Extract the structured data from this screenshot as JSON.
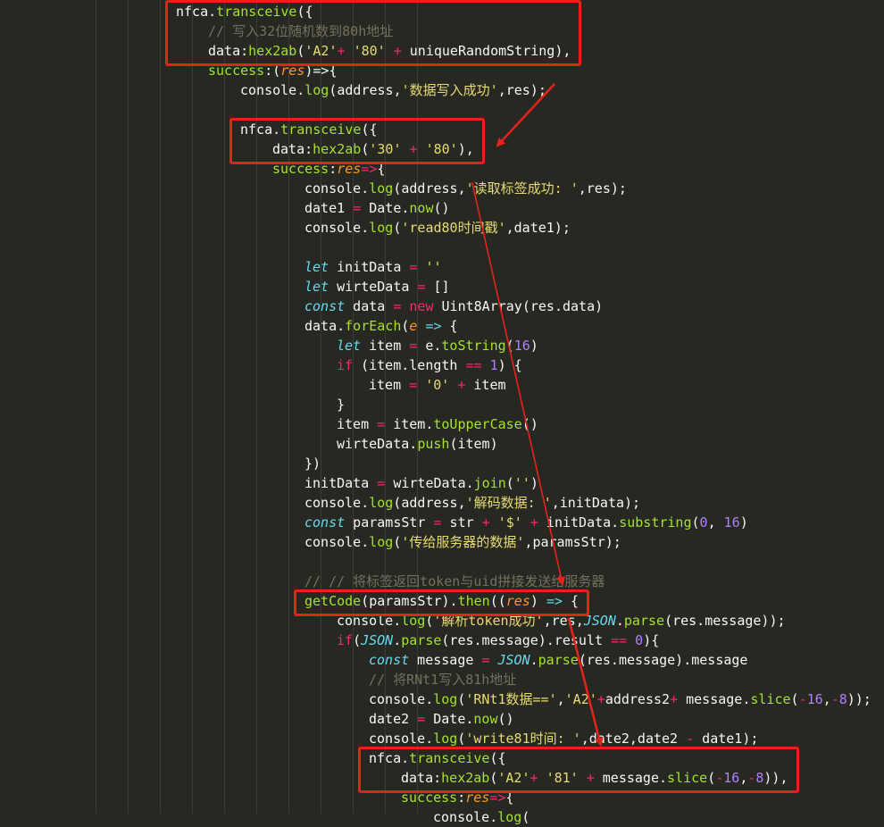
{
  "editor": {
    "theme": {
      "background": "#272822",
      "indent_guide": "#3b3c35",
      "annotation": "#e8221b"
    },
    "lines": [
      {
        "indent": 3,
        "tokens": [
          [
            "plain",
            "nfca."
          ],
          [
            "fn",
            "transceive"
          ],
          [
            "plain",
            "({"
          ]
        ]
      },
      {
        "indent": 4,
        "tokens": [
          [
            "cm",
            "// 写入32位随机数到80h地址"
          ]
        ]
      },
      {
        "indent": 4,
        "tokens": [
          [
            "plain",
            "data:"
          ],
          [
            "fn",
            "hex2ab"
          ],
          [
            "plain",
            "("
          ],
          [
            "str",
            "'A2'"
          ],
          [
            "op",
            "+"
          ],
          [
            "plain",
            " "
          ],
          [
            "str",
            "'80'"
          ],
          [
            "plain",
            " "
          ],
          [
            "op",
            "+"
          ],
          [
            "plain",
            " uniqueRandomString),"
          ]
        ]
      },
      {
        "indent": 4,
        "tokens": [
          [
            "fn",
            "success"
          ],
          [
            "plain",
            ":("
          ],
          [
            "par",
            "res"
          ],
          [
            "plain",
            ")=>{"
          ]
        ]
      },
      {
        "indent": 5,
        "tokens": [
          [
            "plain",
            "console."
          ],
          [
            "fn",
            "log"
          ],
          [
            "plain",
            "(address,"
          ],
          [
            "str",
            "'数据写入成功'"
          ],
          [
            "plain",
            ",res);"
          ]
        ]
      },
      {
        "indent": 0,
        "tokens": []
      },
      {
        "indent": 5,
        "tokens": [
          [
            "plain",
            "nfca."
          ],
          [
            "fn",
            "transceive"
          ],
          [
            "plain",
            "({"
          ]
        ]
      },
      {
        "indent": 6,
        "tokens": [
          [
            "plain",
            "data:"
          ],
          [
            "fn",
            "hex2ab"
          ],
          [
            "plain",
            "("
          ],
          [
            "str",
            "'30'"
          ],
          [
            "plain",
            " "
          ],
          [
            "op",
            "+"
          ],
          [
            "plain",
            " "
          ],
          [
            "str",
            "'80'"
          ],
          [
            "plain",
            "),"
          ]
        ]
      },
      {
        "indent": 6,
        "tokens": [
          [
            "fn",
            "success"
          ],
          [
            "plain",
            ":"
          ],
          [
            "par",
            "res"
          ],
          [
            "op",
            "=>"
          ],
          [
            "plain",
            "{"
          ]
        ]
      },
      {
        "indent": 7,
        "tokens": [
          [
            "plain",
            "console."
          ],
          [
            "fn",
            "log"
          ],
          [
            "plain",
            "(address,"
          ],
          [
            "str",
            "'读取标签成功: '"
          ],
          [
            "plain",
            ",res);"
          ]
        ]
      },
      {
        "indent": 7,
        "tokens": [
          [
            "plain",
            "date1 "
          ],
          [
            "op",
            "="
          ],
          [
            "plain",
            " Date."
          ],
          [
            "fn",
            "now"
          ],
          [
            "plain",
            "()"
          ]
        ]
      },
      {
        "indent": 7,
        "tokens": [
          [
            "plain",
            "console."
          ],
          [
            "fn",
            "log"
          ],
          [
            "plain",
            "("
          ],
          [
            "str",
            "'read80时间戳'"
          ],
          [
            "plain",
            ",date1);"
          ]
        ]
      },
      {
        "indent": 0,
        "tokens": []
      },
      {
        "indent": 7,
        "tokens": [
          [
            "kw",
            "let"
          ],
          [
            "plain",
            " initData "
          ],
          [
            "op",
            "="
          ],
          [
            "plain",
            " "
          ],
          [
            "str",
            "''"
          ]
        ]
      },
      {
        "indent": 7,
        "tokens": [
          [
            "kw",
            "let"
          ],
          [
            "plain",
            " wirteData "
          ],
          [
            "op",
            "="
          ],
          [
            "plain",
            " []"
          ]
        ]
      },
      {
        "indent": 7,
        "tokens": [
          [
            "kw",
            "const"
          ],
          [
            "plain",
            " data "
          ],
          [
            "op",
            "="
          ],
          [
            "plain",
            " "
          ],
          [
            "op",
            "new"
          ],
          [
            "plain",
            " Uint8Array(res.data)"
          ]
        ]
      },
      {
        "indent": 7,
        "tokens": [
          [
            "plain",
            "data."
          ],
          [
            "fn",
            "forEach"
          ],
          [
            "plain",
            "("
          ],
          [
            "par",
            "e"
          ],
          [
            "plain",
            " "
          ],
          [
            "kw",
            "=>"
          ],
          [
            "plain",
            " {"
          ]
        ]
      },
      {
        "indent": 8,
        "tokens": [
          [
            "kw",
            "let"
          ],
          [
            "plain",
            " item "
          ],
          [
            "op",
            "="
          ],
          [
            "plain",
            " e."
          ],
          [
            "fn",
            "toString"
          ],
          [
            "plain",
            "("
          ],
          [
            "num",
            "16"
          ],
          [
            "plain",
            ")"
          ]
        ]
      },
      {
        "indent": 8,
        "tokens": [
          [
            "op",
            "if"
          ],
          [
            "plain",
            " (item.length "
          ],
          [
            "op",
            "=="
          ],
          [
            "plain",
            " "
          ],
          [
            "num",
            "1"
          ],
          [
            "plain",
            ") {"
          ]
        ]
      },
      {
        "indent": 9,
        "tokens": [
          [
            "plain",
            "item "
          ],
          [
            "op",
            "="
          ],
          [
            "plain",
            " "
          ],
          [
            "str",
            "'0'"
          ],
          [
            "plain",
            " "
          ],
          [
            "op",
            "+"
          ],
          [
            "plain",
            " item"
          ]
        ]
      },
      {
        "indent": 8,
        "tokens": [
          [
            "plain",
            "}"
          ]
        ]
      },
      {
        "indent": 8,
        "tokens": [
          [
            "plain",
            "item "
          ],
          [
            "op",
            "="
          ],
          [
            "plain",
            " item."
          ],
          [
            "fn",
            "toUpperCase"
          ],
          [
            "plain",
            "()"
          ]
        ]
      },
      {
        "indent": 8,
        "tokens": [
          [
            "plain",
            "wirteData."
          ],
          [
            "fn",
            "push"
          ],
          [
            "plain",
            "(item)"
          ]
        ]
      },
      {
        "indent": 7,
        "tokens": [
          [
            "plain",
            "})"
          ]
        ]
      },
      {
        "indent": 7,
        "tokens": [
          [
            "plain",
            "initData "
          ],
          [
            "op",
            "="
          ],
          [
            "plain",
            " wirteData."
          ],
          [
            "fn",
            "join"
          ],
          [
            "plain",
            "("
          ],
          [
            "str",
            "''"
          ],
          [
            "plain",
            ")"
          ]
        ]
      },
      {
        "indent": 7,
        "tokens": [
          [
            "plain",
            "console."
          ],
          [
            "fn",
            "log"
          ],
          [
            "plain",
            "(address,"
          ],
          [
            "str",
            "'解码数据: '"
          ],
          [
            "plain",
            ",initData);"
          ]
        ]
      },
      {
        "indent": 7,
        "tokens": [
          [
            "kw",
            "const"
          ],
          [
            "plain",
            " paramsStr "
          ],
          [
            "op",
            "="
          ],
          [
            "plain",
            " str "
          ],
          [
            "op",
            "+"
          ],
          [
            "plain",
            " "
          ],
          [
            "str",
            "'$'"
          ],
          [
            "plain",
            " "
          ],
          [
            "op",
            "+"
          ],
          [
            "plain",
            " initData."
          ],
          [
            "fn",
            "substring"
          ],
          [
            "plain",
            "("
          ],
          [
            "num",
            "0"
          ],
          [
            "plain",
            ", "
          ],
          [
            "num",
            "16"
          ],
          [
            "plain",
            ")"
          ]
        ]
      },
      {
        "indent": 7,
        "tokens": [
          [
            "plain",
            "console."
          ],
          [
            "fn",
            "log"
          ],
          [
            "plain",
            "("
          ],
          [
            "str",
            "'传给服务器的数据'"
          ],
          [
            "plain",
            ",paramsStr);"
          ]
        ]
      },
      {
        "indent": 0,
        "tokens": []
      },
      {
        "indent": 7,
        "tokens": [
          [
            "cm",
            "// // 将标签返回token与uid拼接发送给服务器"
          ]
        ]
      },
      {
        "indent": 7,
        "tokens": [
          [
            "fn",
            "getCode"
          ],
          [
            "plain",
            "(paramsStr)."
          ],
          [
            "fn",
            "then"
          ],
          [
            "plain",
            "(("
          ],
          [
            "par",
            "res"
          ],
          [
            "plain",
            ") "
          ],
          [
            "kw",
            "=>"
          ],
          [
            "plain",
            " {"
          ]
        ]
      },
      {
        "indent": 8,
        "tokens": [
          [
            "plain",
            "console."
          ],
          [
            "fn",
            "log"
          ],
          [
            "plain",
            "("
          ],
          [
            "str",
            "'解析token成功'"
          ],
          [
            "plain",
            ",res,"
          ],
          [
            "kw",
            "JSON"
          ],
          [
            "plain",
            "."
          ],
          [
            "fn",
            "parse"
          ],
          [
            "plain",
            "(res.message));"
          ]
        ]
      },
      {
        "indent": 8,
        "tokens": [
          [
            "op",
            "if"
          ],
          [
            "plain",
            "("
          ],
          [
            "kw",
            "JSON"
          ],
          [
            "plain",
            "."
          ],
          [
            "fn",
            "parse"
          ],
          [
            "plain",
            "(res.message).result "
          ],
          [
            "op",
            "=="
          ],
          [
            "plain",
            " "
          ],
          [
            "num",
            "0"
          ],
          [
            "plain",
            "){"
          ]
        ]
      },
      {
        "indent": 9,
        "tokens": [
          [
            "kw",
            "const"
          ],
          [
            "plain",
            " message "
          ],
          [
            "op",
            "="
          ],
          [
            "plain",
            " "
          ],
          [
            "kw",
            "JSON"
          ],
          [
            "plain",
            "."
          ],
          [
            "fn",
            "parse"
          ],
          [
            "plain",
            "(res.message).message"
          ]
        ]
      },
      {
        "indent": 9,
        "tokens": [
          [
            "cm",
            "// 将RNt1写入81h地址"
          ]
        ]
      },
      {
        "indent": 9,
        "tokens": [
          [
            "plain",
            "console."
          ],
          [
            "fn",
            "log"
          ],
          [
            "plain",
            "("
          ],
          [
            "str",
            "'RNt1数据=='"
          ],
          [
            "plain",
            ","
          ],
          [
            "str",
            "'A2'"
          ],
          [
            "op",
            "+"
          ],
          [
            "plain",
            "address2"
          ],
          [
            "op",
            "+"
          ],
          [
            "plain",
            " message."
          ],
          [
            "fn",
            "slice"
          ],
          [
            "plain",
            "("
          ],
          [
            "op",
            "-"
          ],
          [
            "num",
            "16"
          ],
          [
            "plain",
            ","
          ],
          [
            "op",
            "-"
          ],
          [
            "num",
            "8"
          ],
          [
            "plain",
            "));"
          ]
        ]
      },
      {
        "indent": 9,
        "tokens": [
          [
            "plain",
            "date2 "
          ],
          [
            "op",
            "="
          ],
          [
            "plain",
            " Date."
          ],
          [
            "fn",
            "now"
          ],
          [
            "plain",
            "()"
          ]
        ]
      },
      {
        "indent": 9,
        "tokens": [
          [
            "plain",
            "console."
          ],
          [
            "fn",
            "log"
          ],
          [
            "plain",
            "("
          ],
          [
            "str",
            "'write81时间: '"
          ],
          [
            "plain",
            ",date2,date2 "
          ],
          [
            "op",
            "-"
          ],
          [
            "plain",
            " date1);"
          ]
        ]
      },
      {
        "indent": 9,
        "tokens": [
          [
            "plain",
            "nfca."
          ],
          [
            "fn",
            "transceive"
          ],
          [
            "plain",
            "({"
          ]
        ]
      },
      {
        "indent": 10,
        "tokens": [
          [
            "plain",
            "data:"
          ],
          [
            "fn",
            "hex2ab"
          ],
          [
            "plain",
            "("
          ],
          [
            "str",
            "'A2'"
          ],
          [
            "op",
            "+"
          ],
          [
            "plain",
            " "
          ],
          [
            "str",
            "'81'"
          ],
          [
            "plain",
            " "
          ],
          [
            "op",
            "+"
          ],
          [
            "plain",
            " message."
          ],
          [
            "fn",
            "slice"
          ],
          [
            "plain",
            "("
          ],
          [
            "op",
            "-"
          ],
          [
            "num",
            "16"
          ],
          [
            "plain",
            ","
          ],
          [
            "op",
            "-"
          ],
          [
            "num",
            "8"
          ],
          [
            "plain",
            ")),"
          ]
        ]
      },
      {
        "indent": 10,
        "tokens": [
          [
            "fn",
            "success"
          ],
          [
            "plain",
            ":"
          ],
          [
            "par",
            "res"
          ],
          [
            "op",
            "=>"
          ],
          [
            "plain",
            "{"
          ]
        ]
      },
      {
        "indent": 11,
        "tokens": [
          [
            "plain",
            "console."
          ],
          [
            "fn",
            "log"
          ],
          [
            "plain",
            "("
          ]
        ]
      }
    ],
    "highlights": [
      {
        "name": "highlight-transceive-80h",
        "first_line": 0,
        "last_line": 2
      },
      {
        "name": "highlight-read-30-80",
        "first_line": 6,
        "last_line": 7
      },
      {
        "name": "highlight-getcode",
        "first_line": 30,
        "last_line": 30
      },
      {
        "name": "highlight-transceive-81h",
        "first_line": 38,
        "last_line": 39
      }
    ],
    "arrows": [
      {
        "name": "arrow-write-to-read",
        "from": "highlight-transceive-80h",
        "to": "highlight-read-30-80"
      },
      {
        "name": "arrow-read-to-getcode",
        "from": "highlight-read-30-80",
        "to": "highlight-getcode"
      },
      {
        "name": "arrow-getcode-to-write81",
        "from": "highlight-getcode",
        "to": "highlight-transceive-81h"
      }
    ]
  }
}
